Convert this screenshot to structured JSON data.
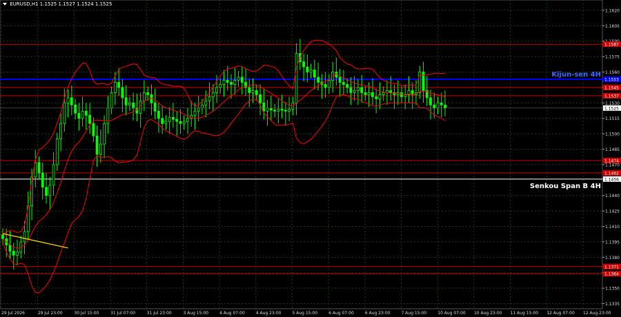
{
  "header": {
    "symbol_info": "EURUSD,H1  1.1525 1.1527 1.1524 1.1525"
  },
  "colors": {
    "background": "#000000",
    "grid": "#1e3a1e",
    "bull": "#00ff00",
    "bear": "#00ff00",
    "resistance": "#cc0000",
    "kijun": "#0000ff",
    "senkou": "#ffffff",
    "trend": "#ffd700",
    "bollinger": "#ff0000"
  },
  "annotations": {
    "kijun_label": "Kijun-sen 4H",
    "senkou_label": "Senkou Span B 4H",
    "current_price_tag": "1.1525"
  },
  "chart_data": {
    "type": "candlestick",
    "symbol": "EURUSD",
    "timeframe": "H1",
    "ylim": [
      1.133,
      1.163
    ],
    "y_ticks": [
      "1.1620",
      "1.1605",
      "1.1590",
      "1.1575",
      "1.1560",
      "1.1545",
      "1.1530",
      "1.1515",
      "1.1500",
      "1.1485",
      "1.1470",
      "1.1456",
      "1.1440",
      "1.1425",
      "1.1410",
      "1.1395",
      "1.1380",
      "1.1365",
      "1.1350",
      "1.1335"
    ],
    "x_ticks": [
      "29 Jul 2026",
      "29 Jul 23:00",
      "30 Jul 15:00",
      "31 Jul 07:00",
      "31 Jul 23:00",
      "3 Aug 15:00",
      "4 Aug 07:00",
      "4 Aug 23:00",
      "5 Aug 15:00",
      "6 Aug 07:00",
      "6 Aug 23:00",
      "7 Aug 15:00",
      "10 Aug 07:00",
      "10 Aug 23:00",
      "11 Aug 15:00",
      "12 Aug 07:00",
      "12 Aug 23:00"
    ],
    "horizontal_lines": [
      {
        "name": "resistance",
        "price": 1.1587,
        "label": "1.1587"
      },
      {
        "name": "resistance",
        "price": 1.1545,
        "label": "1.1545"
      },
      {
        "name": "resistance",
        "price": 1.1537,
        "label": "1.1537"
      },
      {
        "name": "kijun",
        "price": 1.1553,
        "label": "1.1553"
      },
      {
        "name": "resistance",
        "price": 1.1474,
        "label": "1.1474"
      },
      {
        "name": "resistance",
        "price": 1.1462,
        "label": "1.1462"
      },
      {
        "name": "senkou",
        "price": 1.1456,
        "label": "1.1456"
      },
      {
        "name": "resistance",
        "price": 1.1371,
        "label": "1.1371"
      },
      {
        "name": "resistance",
        "price": 1.1364,
        "label": "1.1364"
      }
    ],
    "close": [
      1.1398,
      1.1392,
      1.1386,
      1.1382,
      1.1385,
      1.1395,
      1.1405,
      1.143,
      1.1458,
      1.1472,
      1.1462,
      1.1448,
      1.144,
      1.145,
      1.147,
      1.1495,
      1.151,
      1.153,
      1.1535,
      1.1528,
      1.152,
      1.1515,
      1.1522,
      1.1518,
      1.151,
      1.1498,
      1.148,
      1.149,
      1.151,
      1.1525,
      1.154,
      1.155,
      1.1545,
      1.1535,
      1.1528,
      1.153,
      1.1525,
      1.152,
      1.1532,
      1.154,
      1.1538,
      1.153,
      1.1522,
      1.1515,
      1.151,
      1.1512,
      1.1516,
      1.1514,
      1.1512,
      1.151,
      1.1512,
      1.1515,
      1.1518,
      1.1522,
      1.1525,
      1.1528,
      1.1532,
      1.1536,
      1.154,
      1.1545,
      1.1548,
      1.1552,
      1.155,
      1.1548,
      1.1552,
      1.1555,
      1.155,
      1.1545,
      1.154,
      1.1542,
      1.1538,
      1.153,
      1.1522,
      1.1525,
      1.1523,
      1.1522,
      1.1524,
      1.1523,
      1.1522,
      1.1524,
      1.153,
      1.1578,
      1.157,
      1.1565,
      1.156,
      1.1562,
      1.1555,
      1.155,
      1.1548,
      1.1545,
      1.1552,
      1.156,
      1.1555,
      1.155,
      1.1548,
      1.1545,
      1.154,
      1.1542,
      1.1545,
      1.154,
      1.1538,
      1.154,
      1.1536,
      1.1534,
      1.1538,
      1.154,
      1.1542,
      1.154,
      1.1538,
      1.154,
      1.1536,
      1.1538,
      1.1542,
      1.1538,
      1.154,
      1.156,
      1.1542,
      1.1535,
      1.1528,
      1.1525,
      1.153,
      1.1528,
      1.1525
    ],
    "highs_lows_note": "approximate, derived from closes"
  }
}
